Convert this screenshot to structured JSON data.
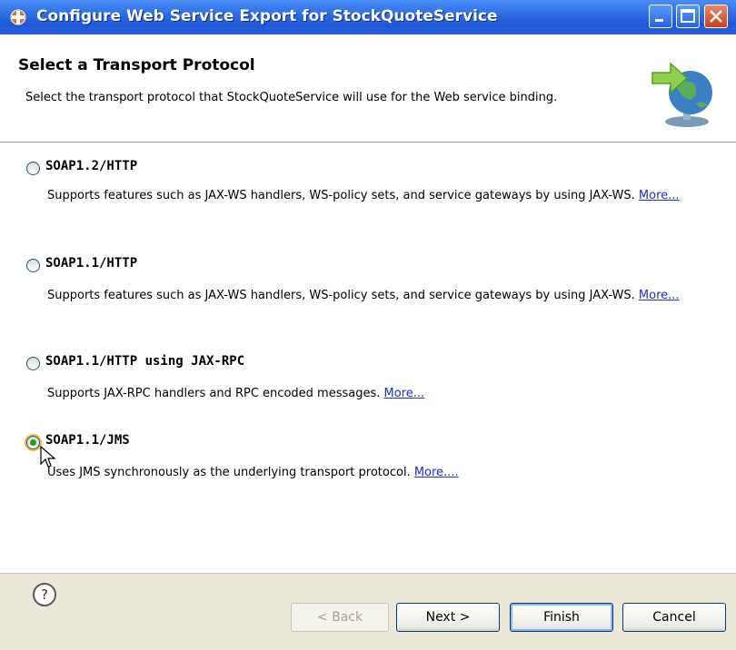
{
  "window": {
    "title": "Configure Web Service Export for StockQuoteService"
  },
  "header": {
    "title": "Select a Transport Protocol",
    "description": "Select the transport protocol that StockQuoteService will use for the Web service binding."
  },
  "options": [
    {
      "label": "SOAP1.2/HTTP",
      "description": "Supports features such as JAX-WS handlers, WS-policy sets, and service gateways by using JAX-WS.",
      "more": "More...",
      "selected": false
    },
    {
      "label": "SOAP1.1/HTTP",
      "description": "Supports features such as JAX-WS handlers, WS-policy sets, and service gateways by using JAX-WS.",
      "more": "More...",
      "selected": false
    },
    {
      "label": "SOAP1.1/HTTP using JAX-RPC",
      "description": "Supports JAX-RPC handlers and RPC encoded messages.",
      "more": "More...",
      "selected": false
    },
    {
      "label": "SOAP1.1/JMS",
      "description": "Uses JMS synchronously as the underlying transport protocol.",
      "more": "More....",
      "selected": true
    }
  ],
  "buttons": {
    "help": "?",
    "back": "< Back",
    "next": "Next >",
    "finish": "Finish",
    "cancel": "Cancel"
  },
  "icons": {
    "title": "gear-icon",
    "header": "globe-arrow-icon",
    "help": "help-icon"
  }
}
